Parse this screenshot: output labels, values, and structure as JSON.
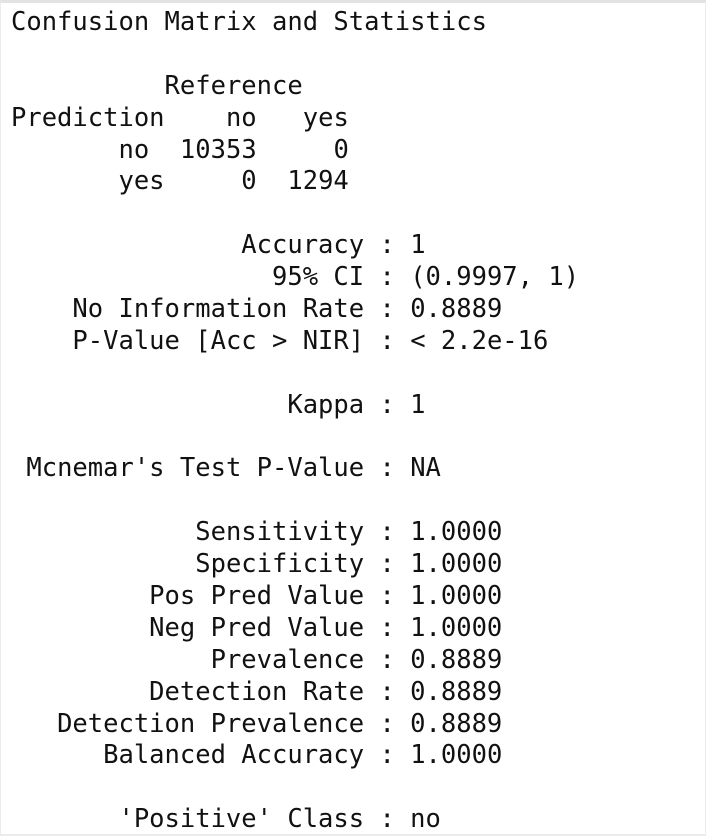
{
  "console": {
    "title": "Confusion Matrix and Statistics",
    "matrix": {
      "reference_label": "Reference",
      "prediction_label": "Prediction",
      "columns": [
        "no",
        "yes"
      ],
      "rows": [
        {
          "label": "no",
          "values": [
            "10353",
            "0"
          ]
        },
        {
          "label": "yes",
          "values": [
            "0",
            "1294"
          ]
        }
      ]
    },
    "overall": [
      {
        "label": "Accuracy",
        "value": "1"
      },
      {
        "label": "95% CI",
        "value": "(0.9997, 1)"
      },
      {
        "label": "No Information Rate",
        "value": "0.8889"
      },
      {
        "label": "P-Value [Acc > NIR]",
        "value": "< 2.2e-16"
      }
    ],
    "kappa": {
      "label": "Kappa",
      "value": "1"
    },
    "mcnemar": {
      "label": "Mcnemar's Test P-Value",
      "value": "NA"
    },
    "class_stats": [
      {
        "label": "Sensitivity",
        "value": "1.0000"
      },
      {
        "label": "Specificity",
        "value": "1.0000"
      },
      {
        "label": "Pos Pred Value",
        "value": "1.0000"
      },
      {
        "label": "Neg Pred Value",
        "value": "1.0000"
      },
      {
        "label": "Prevalence",
        "value": "0.8889"
      },
      {
        "label": "Detection Rate",
        "value": "0.8889"
      },
      {
        "label": "Detection Prevalence",
        "value": "0.8889"
      },
      {
        "label": "Balanced Accuracy",
        "value": "1.0000"
      }
    ],
    "positive_class": {
      "label": "'Positive' Class",
      "value": "no"
    }
  }
}
